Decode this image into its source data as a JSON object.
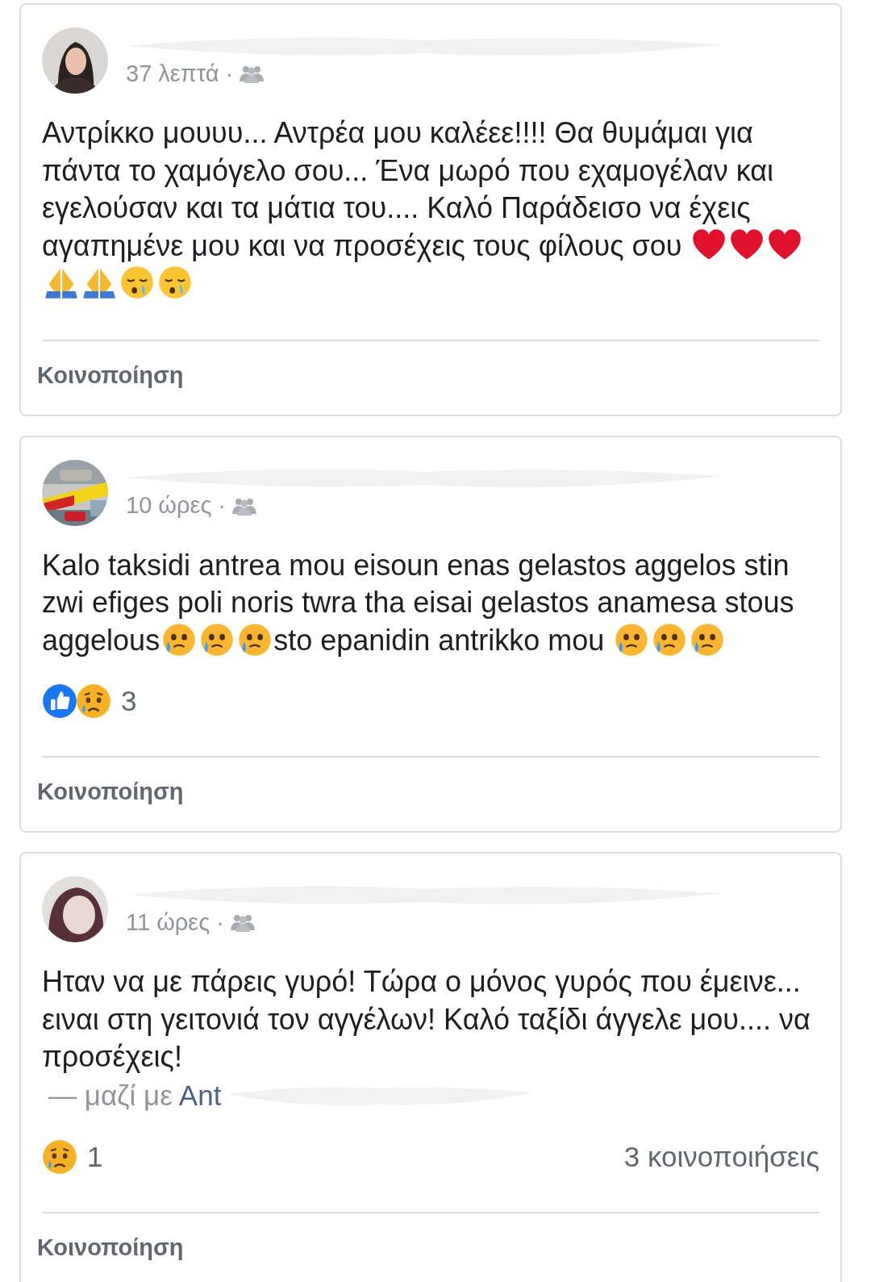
{
  "posts": [
    {
      "time": "37 λεπτά",
      "separator": "·",
      "body": [
        {
          "kind": "text",
          "text": "Αντρίκκο μουυυ... Αντρέα μου καλέεε!!!! Θα θυμάμαι για πάντα το χαμόγελο σου... Ένα μωρό που εχαμογέλαν και εγελούσαν και τα μάτια του.... Καλό Παράδεισο να έχεις αγαπημένε μου και να προσέχεις τους φίλους σου "
        },
        {
          "kind": "heart"
        },
        {
          "kind": "heart"
        },
        {
          "kind": "heart"
        },
        {
          "kind": "pray"
        },
        {
          "kind": "pray"
        },
        {
          "kind": "sleepy"
        },
        {
          "kind": "sleepy"
        }
      ],
      "action": "Κοινοποίηση"
    },
    {
      "time": "10 ώρες",
      "separator": "·",
      "body": [
        {
          "kind": "text",
          "text": "Kalo taksidi antrea mou eisoun enas gelastos aggelos stin zwi efiges poli noris twra tha eisai gelastos anamesa stous aggelous"
        },
        {
          "kind": "tearful"
        },
        {
          "kind": "tearful"
        },
        {
          "kind": "tearful"
        },
        {
          "kind": "text",
          "text": "sto epanidin antrikko mou "
        },
        {
          "kind": "tearful"
        },
        {
          "kind": "tearful"
        },
        {
          "kind": "tearful"
        }
      ],
      "reactions": [
        {
          "kind": "like"
        },
        {
          "kind": "sad"
        }
      ],
      "reaction_count": "3",
      "action": "Κοινοποίηση"
    },
    {
      "time": "11 ώρες",
      "separator": "·",
      "body": [
        {
          "kind": "text",
          "text": "Ηταν να με πάρεις γυρό! Τώρα ο μόνος γυρός που έμεινε... ειναι στη γειτονιά τον αγγέλων! Καλό ταξίδι άγγελε μου.... να προσέχεις!"
        }
      ],
      "tag_prefix": "— μαζί με",
      "tag_name": "Ant",
      "reactions": [
        {
          "kind": "sad"
        }
      ],
      "reaction_count": "1",
      "shares": "3 κοινοποιήσεις",
      "action": "Κοινοποίηση"
    }
  ]
}
